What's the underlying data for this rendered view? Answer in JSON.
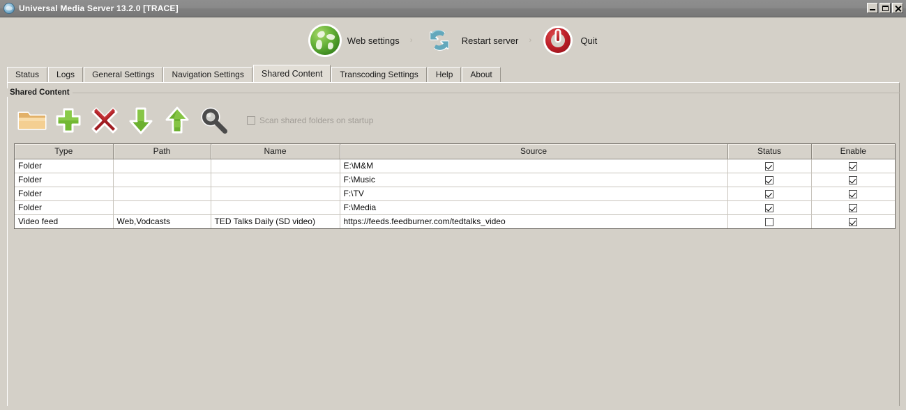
{
  "window": {
    "title": "Universal Media Server 13.2.0  [TRACE]",
    "app_icon": "ums-globe-icon",
    "controls": {
      "minimize": "minimize-button",
      "maximize": "maximize-button",
      "close": "close-button"
    }
  },
  "toolbar": {
    "items": [
      {
        "icon": "globe-icon",
        "label": "Web settings"
      },
      {
        "icon": "restart-arrows-icon",
        "label": "Restart server"
      },
      {
        "icon": "power-icon",
        "label": "Quit"
      }
    ],
    "separator": "›"
  },
  "tabs": [
    {
      "label": "Status",
      "selected": false
    },
    {
      "label": "Logs",
      "selected": false
    },
    {
      "label": "General Settings",
      "selected": false
    },
    {
      "label": "Navigation Settings",
      "selected": false
    },
    {
      "label": "Shared Content",
      "selected": true
    },
    {
      "label": "Transcoding Settings",
      "selected": false
    },
    {
      "label": "Help",
      "selected": false
    },
    {
      "label": "About",
      "selected": false
    }
  ],
  "panel": {
    "group_title": "Shared Content",
    "actions": [
      {
        "icon": "folder-icon",
        "name": "add-folder-button"
      },
      {
        "icon": "plus-icon",
        "name": "add-item-button"
      },
      {
        "icon": "red-x-icon",
        "name": "remove-item-button"
      },
      {
        "icon": "arrow-down-icon",
        "name": "move-down-button"
      },
      {
        "icon": "arrow-up-icon",
        "name": "move-up-button"
      },
      {
        "icon": "magnifier-icon",
        "name": "scan-button"
      }
    ],
    "scan_on_startup": {
      "label": "Scan shared folders on startup",
      "checked": false,
      "enabled": false
    }
  },
  "table": {
    "columns": [
      "Type",
      "Path",
      "Name",
      "Source",
      "Status",
      "Enable"
    ],
    "rows": [
      {
        "type": "Folder",
        "path": "",
        "name": "",
        "source": "E:\\M&M",
        "status": true,
        "enable": true
      },
      {
        "type": "Folder",
        "path": "",
        "name": "",
        "source": "F:\\Music",
        "status": true,
        "enable": true
      },
      {
        "type": "Folder",
        "path": "",
        "name": "",
        "source": "F:\\TV",
        "status": true,
        "enable": true
      },
      {
        "type": "Folder",
        "path": "",
        "name": "",
        "source": "F:\\Media",
        "status": true,
        "enable": true
      },
      {
        "type": "Video feed",
        "path": "Web,Vodcasts",
        "name": "TED Talks Daily (SD video)",
        "source": "https://feeds.feedburner.com/tedtalks_video",
        "status": false,
        "enable": true
      }
    ]
  },
  "colors": {
    "window_background": "#d4d0c8",
    "titlebar": "#838383",
    "titlebar_text": "#ffffff",
    "tab_selected": "#e2ded6",
    "grid_header": "#d6d2ca",
    "accent_green": "#69b43a",
    "accent_red": "#c0202a",
    "accent_blue": "#55a0b4",
    "disabled_text": "#a09c96"
  }
}
